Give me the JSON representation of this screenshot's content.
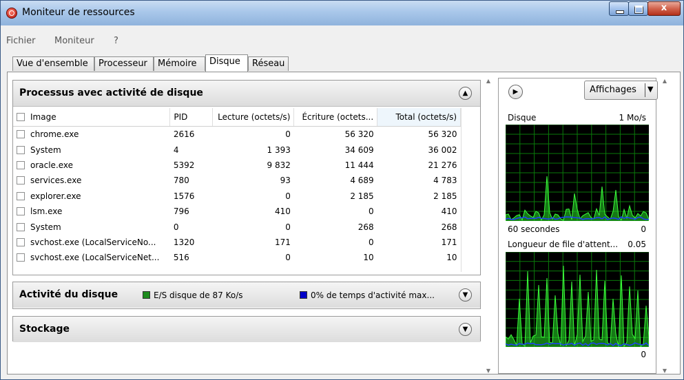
{
  "window": {
    "title": "Moniteur de ressources",
    "controls": {
      "minimize": "minimize",
      "maximize": "maximize",
      "close": "close"
    }
  },
  "menu": [
    "Fichier",
    "Moniteur",
    "?"
  ],
  "tabs": [
    "Vue d'ensemble",
    "Processeur",
    "Mémoire",
    "Disque",
    "Réseau"
  ],
  "active_tab": "Disque",
  "processes": {
    "title": "Processus avec activité de disque",
    "columns": [
      "Image",
      "PID",
      "Lecture (octets/s)",
      "Écriture (octets...",
      "Total (octets/s)"
    ],
    "sorted_column": "Total (octets/s)",
    "rows": [
      [
        "chrome.exe",
        "2616",
        "0",
        "56 320",
        "56 320"
      ],
      [
        "System",
        "4",
        "1 393",
        "34 609",
        "36 002"
      ],
      [
        "oracle.exe",
        "5392",
        "9 832",
        "11 444",
        "21 276"
      ],
      [
        "services.exe",
        "780",
        "93",
        "4 689",
        "4 783"
      ],
      [
        "explorer.exe",
        "1576",
        "0",
        "2 185",
        "2 185"
      ],
      [
        "lsm.exe",
        "796",
        "410",
        "0",
        "410"
      ],
      [
        "System",
        "0",
        "0",
        "268",
        "268"
      ],
      [
        "svchost.exe (LocalServiceNo...",
        "1320",
        "171",
        "0",
        "171"
      ],
      [
        "svchost.exe (LocalServiceNet...",
        "516",
        "0",
        "10",
        "10"
      ]
    ]
  },
  "disk_activity": {
    "title": "Activité du disque",
    "io_label": "E/S disque de 87 Ko/s",
    "active_time_label": "0% de temps d'activité max...",
    "io_color": "#1e8c1e",
    "active_color": "#0000c8"
  },
  "storage": {
    "title": "Stockage"
  },
  "right_panel": {
    "views_button": "Affichages",
    "graph1": {
      "title": "Disque",
      "max": "1 Mo/s",
      "time": "60 secondes",
      "min": "0"
    },
    "graph2": {
      "title": "Longueur de file d'attent...",
      "max": "0.05",
      "min": "0"
    }
  }
}
